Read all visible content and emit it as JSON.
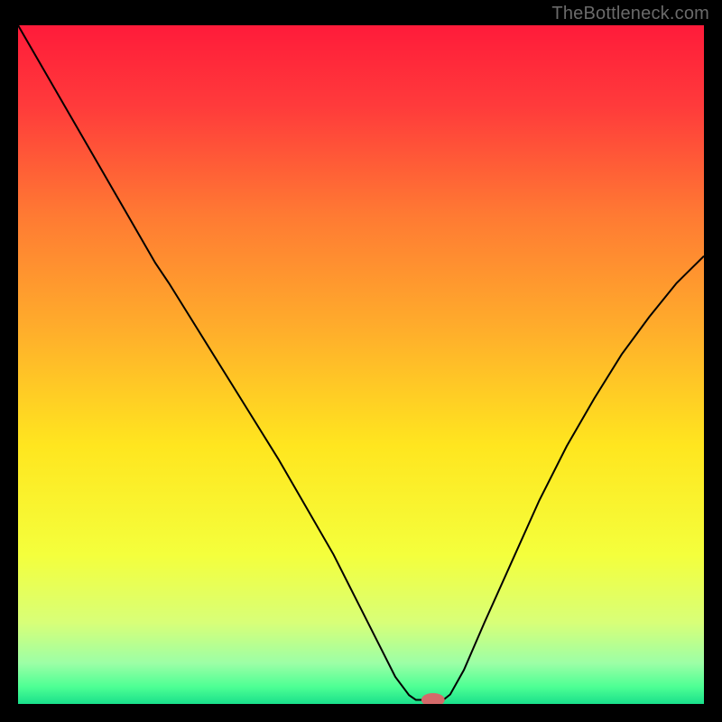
{
  "watermark": "TheBottleneck.com",
  "chart_data": {
    "type": "line",
    "title": "",
    "xlabel": "",
    "ylabel": "",
    "xlim": [
      0,
      100
    ],
    "ylim": [
      0,
      100
    ],
    "grid": false,
    "legend": false,
    "background_gradient": {
      "stops": [
        {
          "offset": 0.0,
          "color": "#ff1b3a"
        },
        {
          "offset": 0.12,
          "color": "#ff3b3b"
        },
        {
          "offset": 0.28,
          "color": "#ff7a33"
        },
        {
          "offset": 0.45,
          "color": "#ffae2b"
        },
        {
          "offset": 0.62,
          "color": "#ffe61f"
        },
        {
          "offset": 0.78,
          "color": "#f4ff3c"
        },
        {
          "offset": 0.88,
          "color": "#d8ff78"
        },
        {
          "offset": 0.94,
          "color": "#9cffa6"
        },
        {
          "offset": 0.975,
          "color": "#4dff94"
        },
        {
          "offset": 1.0,
          "color": "#19e08b"
        }
      ]
    },
    "series": [
      {
        "name": "bottleneck-curve",
        "stroke": "#000000",
        "stroke_width": 2,
        "x": [
          0,
          4,
          8,
          12,
          16,
          20,
          22,
          26,
          30,
          34,
          38,
          42,
          46,
          50,
          53,
          55,
          57,
          58,
          62,
          63,
          65,
          68,
          72,
          76,
          80,
          84,
          88,
          92,
          96,
          100
        ],
        "y": [
          100,
          93,
          86,
          79,
          72,
          65,
          62,
          55.5,
          49,
          42.5,
          36,
          29,
          22,
          14,
          8,
          4,
          1.3,
          0.6,
          0.6,
          1.4,
          5,
          12,
          21,
          30,
          38,
          45,
          51.5,
          57,
          62,
          66
        ]
      }
    ],
    "marker": {
      "name": "optimal-point",
      "x": 60.5,
      "y": 0.6,
      "rx": 1.7,
      "ry": 1.0,
      "fill": "#d46a6a"
    }
  }
}
